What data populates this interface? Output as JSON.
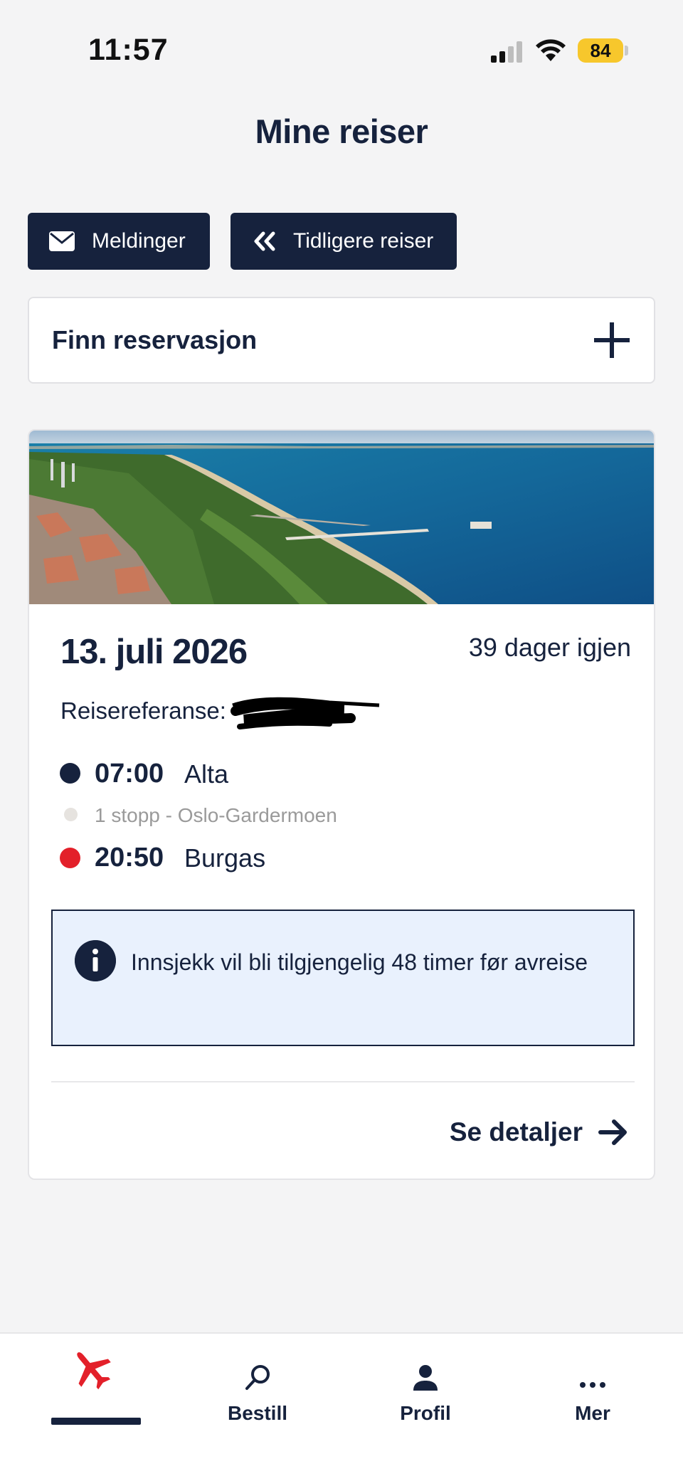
{
  "status_bar": {
    "time": "11:57",
    "battery": "84",
    "icons": [
      "signal-icon",
      "wifi-icon",
      "battery-icon"
    ]
  },
  "header": {
    "title": "Mine reiser"
  },
  "actions": {
    "messages_label": "Meldinger",
    "previous_trips_label": "Tidligere reiser"
  },
  "find_reservation": {
    "label": "Finn reservasjon"
  },
  "trip": {
    "date": "13. juli 2026",
    "days_left": "39 dager igjen",
    "reference_label": "Reisereferanse:",
    "departure": {
      "time": "07:00",
      "place": "Alta"
    },
    "stop_info": "1 stopp - Oslo-Gardermoen",
    "arrival": {
      "time": "20:50",
      "place": "Burgas"
    },
    "checkin_info": "Innsjekk vil bli tilgjengelig 48 timer før avreise",
    "details_label": "Se detaljer"
  },
  "bottom_nav": {
    "items": [
      {
        "label": "",
        "icon": "airplane-icon",
        "active": true
      },
      {
        "label": "Bestill",
        "icon": "search-icon"
      },
      {
        "label": "Profil",
        "icon": "person-icon"
      },
      {
        "label": "Mer",
        "icon": "more-icon"
      }
    ]
  },
  "colors": {
    "navy": "#16223d",
    "accent_red": "#e3202a",
    "info_bg": "#e9f1fd",
    "battery_yellow": "#f7c72c"
  }
}
